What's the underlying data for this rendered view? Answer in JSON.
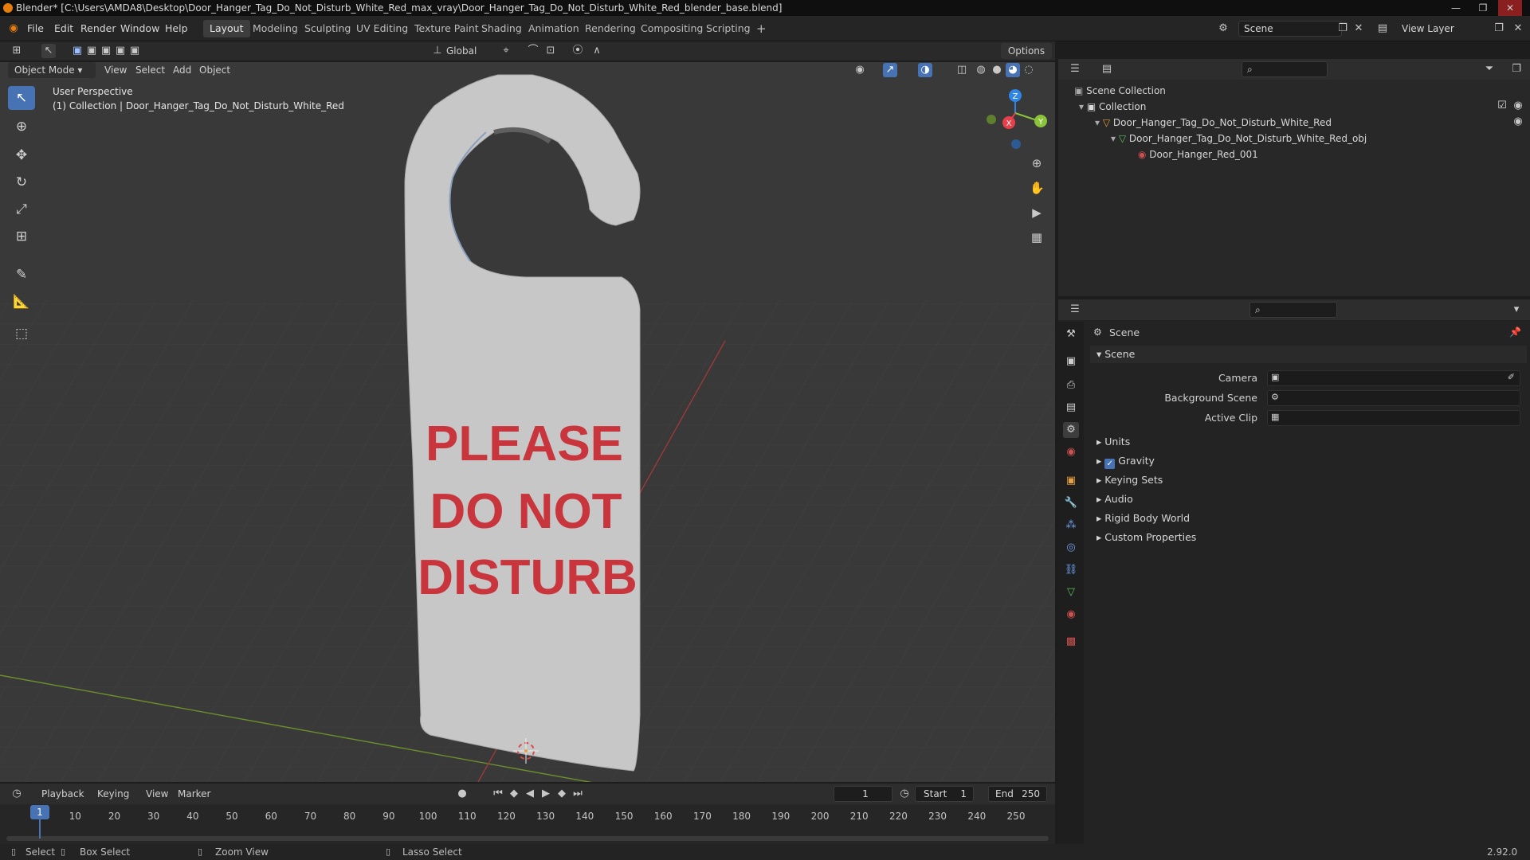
{
  "window": {
    "title": "Blender* [C:\\Users\\AMDA8\\Desktop\\Door_Hanger_Tag_Do_Not_Disturb_White_Red_max_vray\\Door_Hanger_Tag_Do_Not_Disturb_White_Red_blender_base.blend]",
    "controls": [
      "—",
      "❐",
      "✕"
    ]
  },
  "menubar": {
    "items": [
      "File",
      "Edit",
      "Render",
      "Window",
      "Help"
    ]
  },
  "workspaces": [
    "Layout",
    "Modeling",
    "Sculpting",
    "UV Editing",
    "Texture Paint",
    "Shading",
    "Animation",
    "Rendering",
    "Compositing",
    "Scripting"
  ],
  "active_workspace": "Layout",
  "add_workspace": "+",
  "scene_selector": {
    "value": "Scene"
  },
  "viewlayer_selector": {
    "value": "View Layer"
  },
  "viewport_header": {
    "transform_orientation": "Global",
    "options_label": "Options",
    "mode": "Object Mode",
    "menus": [
      "View",
      "Select",
      "Add",
      "Object"
    ]
  },
  "viewport": {
    "overlay_line1": "User Perspective",
    "overlay_line2": "(1) Collection | Door_Hanger_Tag_Do_Not_Disturb_White_Red",
    "tag_text": [
      "PLEASE",
      "DO NOT",
      "DISTURB"
    ],
    "gizmo_axes": {
      "x": "X",
      "y": "Y",
      "z": "Z"
    }
  },
  "outliner": {
    "root": "Scene Collection",
    "rows": [
      {
        "label": "Collection",
        "depth": 1
      },
      {
        "label": "Door_Hanger_Tag_Do_Not_Disturb_White_Red",
        "depth": 2
      },
      {
        "label": "Door_Hanger_Tag_Do_Not_Disturb_White_Red_obj",
        "depth": 3
      },
      {
        "label": "Door_Hanger_Red_001",
        "depth": 4
      }
    ]
  },
  "properties": {
    "context": "Scene",
    "panel_title": "Scene",
    "fields": [
      {
        "label": "Camera"
      },
      {
        "label": "Background Scene"
      },
      {
        "label": "Active Clip"
      }
    ],
    "subpanels": [
      "Units",
      "Gravity",
      "Keying Sets",
      "Audio",
      "Rigid Body World",
      "Custom Properties"
    ],
    "gravity_checked": true
  },
  "timeline": {
    "menus": [
      "Playback",
      "Keying",
      "View",
      "Marker"
    ],
    "current_frame": "1",
    "start_label": "Start",
    "start_value": "1",
    "end_label": "End",
    "end_value": "250",
    "ticks": [
      "1",
      "10",
      "20",
      "30",
      "40",
      "50",
      "60",
      "70",
      "80",
      "90",
      "100",
      "110",
      "120",
      "130",
      "140",
      "150",
      "160",
      "170",
      "180",
      "190",
      "200",
      "210",
      "220",
      "230",
      "240",
      "250"
    ]
  },
  "statusbar": {
    "items": [
      "Select",
      "Box Select",
      "Zoom View",
      "Lasso Select"
    ],
    "version": "2.92.0"
  },
  "colors": {
    "accent": "#4772b3",
    "tag_text": "#c8353c",
    "tag_body": "#c7c7c7",
    "x_axis": "#e8404a",
    "y_axis": "#8bc43a",
    "z_axis": "#2f86e6"
  }
}
